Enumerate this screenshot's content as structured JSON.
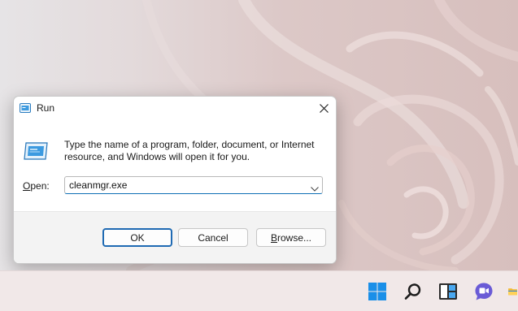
{
  "dialog": {
    "title": "Run",
    "close_icon": "close-icon",
    "description": "Type the name of a program, folder, document, or Internet resource, and Windows will open it for you.",
    "open_label_mnemonic": "O",
    "open_label_rest": "pen:",
    "open_value": "cleanmgr.exe",
    "ok_label": "OK",
    "cancel_label": "Cancel",
    "browse_mnemonic": "B",
    "browse_rest": "rowse..."
  },
  "taskbar": {
    "icons": [
      "windows-start-icon",
      "search-icon",
      "task-view-icon",
      "chat-icon",
      "file-explorer-icon"
    ]
  },
  "colors": {
    "accent": "#1f6ab3",
    "taskbar_bg": "#f1e8e8",
    "dialog_footer": "#f3f3f3"
  }
}
